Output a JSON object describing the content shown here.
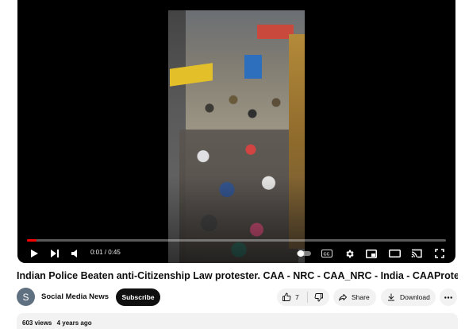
{
  "player": {
    "progress_fraction": 0.022,
    "time": "0:01 / 0:45",
    "controls": {
      "play_icon": "play-icon",
      "next_icon": "next-icon",
      "volume_icon": "volume-icon",
      "autoplay_icon": "autoplay-toggle-icon",
      "captions_icon": "captions-icon",
      "settings_icon": "gear-icon",
      "miniplayer_icon": "miniplayer-icon",
      "theater_icon": "theater-mode-icon",
      "cast_icon": "cast-icon",
      "fullscreen_icon": "fullscreen-icon"
    },
    "accent_color": "#ff0000"
  },
  "video": {
    "title": "Indian Police Beaten anti-Citizenship Law protester. CAA - NRC - CAA_NRC - India - CAAProtest _CAA"
  },
  "channel": {
    "avatar_letter": "S",
    "name": "Social Media News",
    "subscribe_label": "Subscribe"
  },
  "actions": {
    "like_count": "7",
    "share_label": "Share",
    "download_label": "Download"
  },
  "description": {
    "views": "603 views",
    "age": "4 years ago"
  }
}
